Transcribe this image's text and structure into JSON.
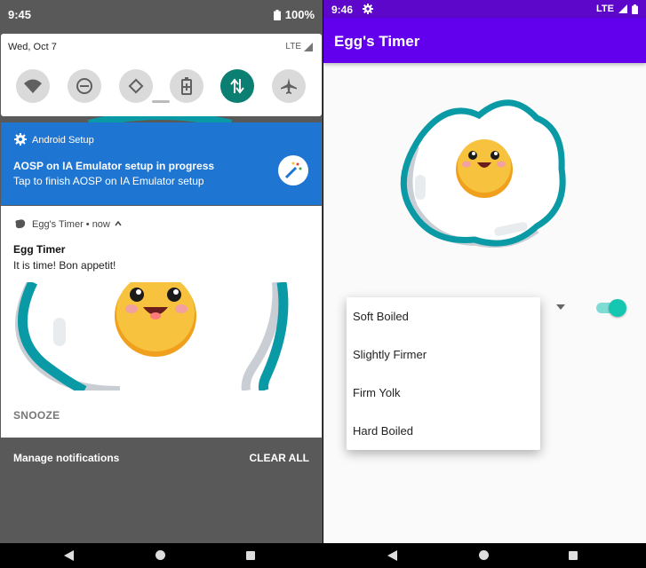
{
  "left": {
    "status": {
      "time": "9:45",
      "battery": "100%"
    },
    "quick_settings": {
      "date": "Wed, Oct 7",
      "network": "LTE"
    },
    "setup_notification": {
      "app": "Android Setup",
      "title": "AOSP on IA Emulator setup in progress",
      "text": "Tap to finish AOSP on IA Emulator setup"
    },
    "timer_notification": {
      "app": "Egg's Timer • now",
      "title": "Egg Timer",
      "text": "It is time! Bon appetit!",
      "action": "SNOOZE"
    },
    "footer": {
      "manage": "Manage notifications",
      "clear_all": "CLEAR ALL"
    }
  },
  "right": {
    "status": {
      "time": "9:46",
      "network": "LTE"
    },
    "appbar": {
      "title": "Egg's Timer"
    },
    "dropdown_options": [
      "Soft Boiled",
      "Slightly Firmer",
      "Firm Yolk",
      "Hard Boiled"
    ],
    "switch_on": true
  },
  "colors": {
    "teal": "#0a9aa6",
    "yolk": "#f7b927",
    "purple": "#6200ee",
    "setup_blue": "#1e76d2"
  }
}
